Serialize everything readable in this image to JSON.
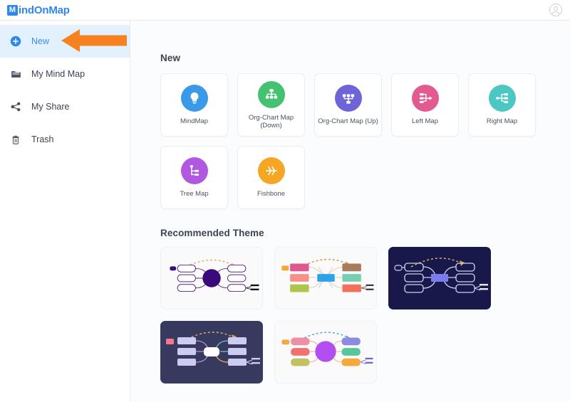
{
  "app": {
    "brand_initial": "M",
    "brand_name": "indOnMap",
    "brand_color": "#2f86eb"
  },
  "topbar": {
    "account_icon": "user-circle-icon"
  },
  "sidebar": {
    "items": [
      {
        "label": "New",
        "icon": "plus-circle-icon",
        "active": true
      },
      {
        "label": "My Mind Map",
        "icon": "folder-icon",
        "active": false
      },
      {
        "label": "My Share",
        "icon": "share-icon",
        "active": false
      },
      {
        "label": "Trash",
        "icon": "trash-icon",
        "active": false
      }
    ]
  },
  "annotation": {
    "arrow": "left-pointing-arrow",
    "color": "#f5821f"
  },
  "main": {
    "new_section": {
      "title": "New",
      "templates": [
        {
          "label": "MindMap",
          "icon": "lightbulb-icon",
          "color": "#3b9ae8"
        },
        {
          "label": "Org-Chart Map (Down)",
          "icon": "org-chart-down-icon",
          "color": "#44c171"
        },
        {
          "label": "Org-Chart Map (Up)",
          "icon": "org-chart-up-icon",
          "color": "#6f63d8"
        },
        {
          "label": "Left Map",
          "icon": "left-map-icon",
          "color": "#e25a91"
        },
        {
          "label": "Right Map",
          "icon": "right-map-icon",
          "color": "#4cc7c4"
        },
        {
          "label": "Tree Map",
          "icon": "tree-map-icon",
          "color": "#b059e0"
        },
        {
          "label": "Fishbone",
          "icon": "fishbone-icon",
          "color": "#f5a623"
        }
      ]
    },
    "theme_section": {
      "title": "Recommended Theme",
      "themes": [
        {
          "name": "theme-violet-light",
          "style": "light",
          "center": "#3b0a7a",
          "accent": "#f3b46a"
        },
        {
          "name": "theme-colorful-light",
          "style": "light",
          "center": "#2aa3e8",
          "accent": "#d99a5c"
        },
        {
          "name": "theme-navy-dark",
          "style": "dark-a",
          "center": "#7b7bf0",
          "accent": "#d1a45e"
        },
        {
          "name": "theme-slate-dark",
          "style": "dark-b",
          "center": "#ffffff",
          "accent": "#d1a45e"
        },
        {
          "name": "theme-purple-light",
          "style": "light",
          "center": "#b44ef0",
          "accent": "#5aa9d6"
        }
      ]
    }
  }
}
